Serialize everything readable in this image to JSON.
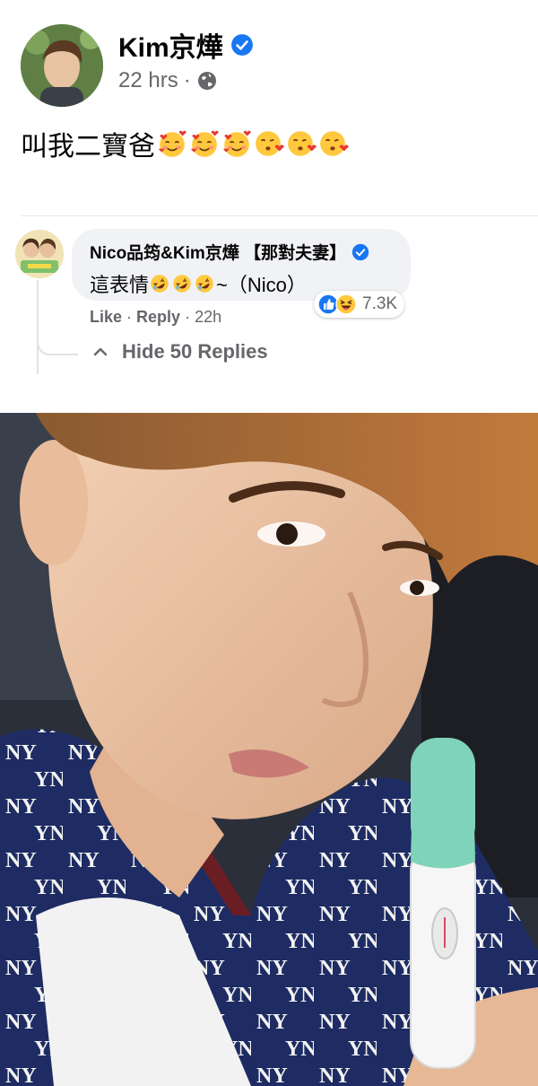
{
  "post": {
    "author": "Kim京燁",
    "time": "22 hrs",
    "separator": "·",
    "text": "叫我二寶爸",
    "emojis": [
      "smiling-face-with-hearts",
      "smiling-face-with-hearts",
      "smiling-face-with-hearts",
      "face-blowing-kiss",
      "face-blowing-kiss",
      "face-blowing-kiss"
    ]
  },
  "comment": {
    "author": "Nico品筠&Kim京燁 【那對夫妻】",
    "text_before": "這表情",
    "emojis": [
      "rolling-on-floor-laughing",
      "rolling-on-floor-laughing",
      "rolling-on-floor-laughing"
    ],
    "text_after": "~（Nico）",
    "reactions": [
      "like",
      "haha"
    ],
    "reaction_count": "7.3K",
    "like_label": "Like",
    "reply_label": "Reply",
    "dot": "·",
    "time": "22h",
    "hide_replies": "Hide 50 Replies"
  },
  "colors": {
    "verified": "#1877f2",
    "secondary_text": "#65676b",
    "bubble": "#f0f2f5",
    "test_cap": "#7fd3b8"
  },
  "photo": {
    "subject": "selfie-holding-pregnancy-test"
  }
}
